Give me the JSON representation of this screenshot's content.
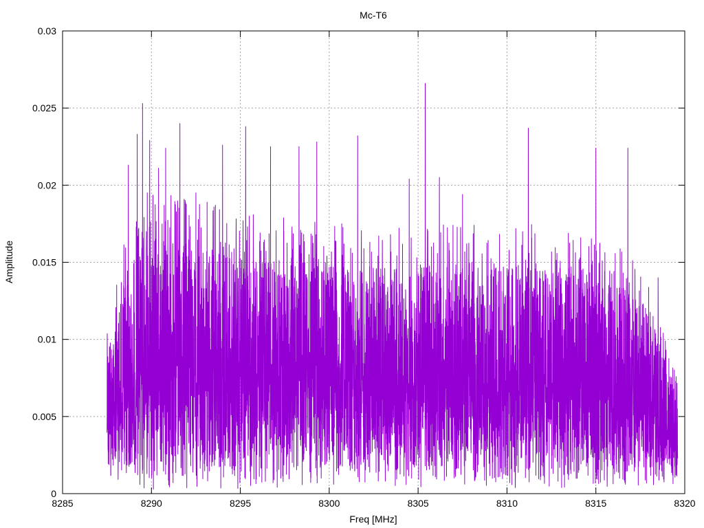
{
  "chart_data": {
    "type": "line",
    "title": "Mc-T6",
    "xlabel": "Freq [MHz]",
    "ylabel": "Amplitude",
    "xlim": [
      8285,
      8320
    ],
    "ylim": [
      0,
      0.03
    ],
    "xticks": [
      8285,
      8290,
      8295,
      8300,
      8305,
      8310,
      8315,
      8320
    ],
    "xtick_labels": [
      "8285",
      "8290",
      "8295",
      "8300",
      "8305",
      "8310",
      "8315",
      "8320"
    ],
    "yticks": [
      0,
      0.005,
      0.01,
      0.015,
      0.02,
      0.025,
      0.03
    ],
    "ytick_labels": [
      "0",
      "0.005",
      "0.01",
      "0.015",
      "0.02",
      "0.025",
      "0.03"
    ],
    "grid": true,
    "legend": "none",
    "series_color": "#9400d3",
    "series": [
      {
        "x_range": [
          8287.5,
          8319.6
        ],
        "peaks": [
          {
            "x": 8288.7,
            "y": 0.0213
          },
          {
            "x": 8289.2,
            "y": 0.0233
          },
          {
            "x": 8289.5,
            "y": 0.0253
          },
          {
            "x": 8289.9,
            "y": 0.0229
          },
          {
            "x": 8290.4,
            "y": 0.0211
          },
          {
            "x": 8290.8,
            "y": 0.0224
          },
          {
            "x": 8291.6,
            "y": 0.024
          },
          {
            "x": 8292.5,
            "y": 0.0195
          },
          {
            "x": 8294.0,
            "y": 0.0226
          },
          {
            "x": 8295.3,
            "y": 0.0238
          },
          {
            "x": 8296.7,
            "y": 0.0225
          },
          {
            "x": 8298.3,
            "y": 0.0225
          },
          {
            "x": 8299.3,
            "y": 0.0228
          },
          {
            "x": 8301.6,
            "y": 0.0232
          },
          {
            "x": 8304.5,
            "y": 0.0204
          },
          {
            "x": 8305.4,
            "y": 0.0266
          },
          {
            "x": 8306.2,
            "y": 0.0205
          },
          {
            "x": 8307.5,
            "y": 0.0194
          },
          {
            "x": 8311.2,
            "y": 0.0237
          },
          {
            "x": 8315.0,
            "y": 0.0224
          },
          {
            "x": 8316.8,
            "y": 0.0224
          },
          {
            "x": 8318.5,
            "y": 0.014
          }
        ],
        "envelope": [
          {
            "x": 8287.5,
            "y_min": 0.001,
            "y_mid": 0.005,
            "y_max": 0.0095
          },
          {
            "x": 8288.5,
            "y_min": 0.0005,
            "y_mid": 0.0065,
            "y_max": 0.015
          },
          {
            "x": 8289.5,
            "y_min": 0.0003,
            "y_mid": 0.008,
            "y_max": 0.018
          },
          {
            "x": 8292.0,
            "y_min": 0.0002,
            "y_mid": 0.008,
            "y_max": 0.0175
          },
          {
            "x": 8296.0,
            "y_min": 0.0003,
            "y_mid": 0.0075,
            "y_max": 0.0165
          },
          {
            "x": 8300.0,
            "y_min": 0.0003,
            "y_mid": 0.0072,
            "y_max": 0.016
          },
          {
            "x": 8304.0,
            "y_min": 0.0003,
            "y_mid": 0.007,
            "y_max": 0.016
          },
          {
            "x": 8308.0,
            "y_min": 0.0003,
            "y_mid": 0.0072,
            "y_max": 0.016
          },
          {
            "x": 8312.0,
            "y_min": 0.0003,
            "y_mid": 0.0072,
            "y_max": 0.016
          },
          {
            "x": 8316.0,
            "y_min": 0.0003,
            "y_mid": 0.0068,
            "y_max": 0.015
          },
          {
            "x": 8318.0,
            "y_min": 0.0005,
            "y_mid": 0.006,
            "y_max": 0.013
          },
          {
            "x": 8319.0,
            "y_min": 0.0005,
            "y_mid": 0.0045,
            "y_max": 0.009
          },
          {
            "x": 8319.6,
            "y_min": 0.0005,
            "y_mid": 0.003,
            "y_max": 0.007
          }
        ]
      }
    ]
  }
}
